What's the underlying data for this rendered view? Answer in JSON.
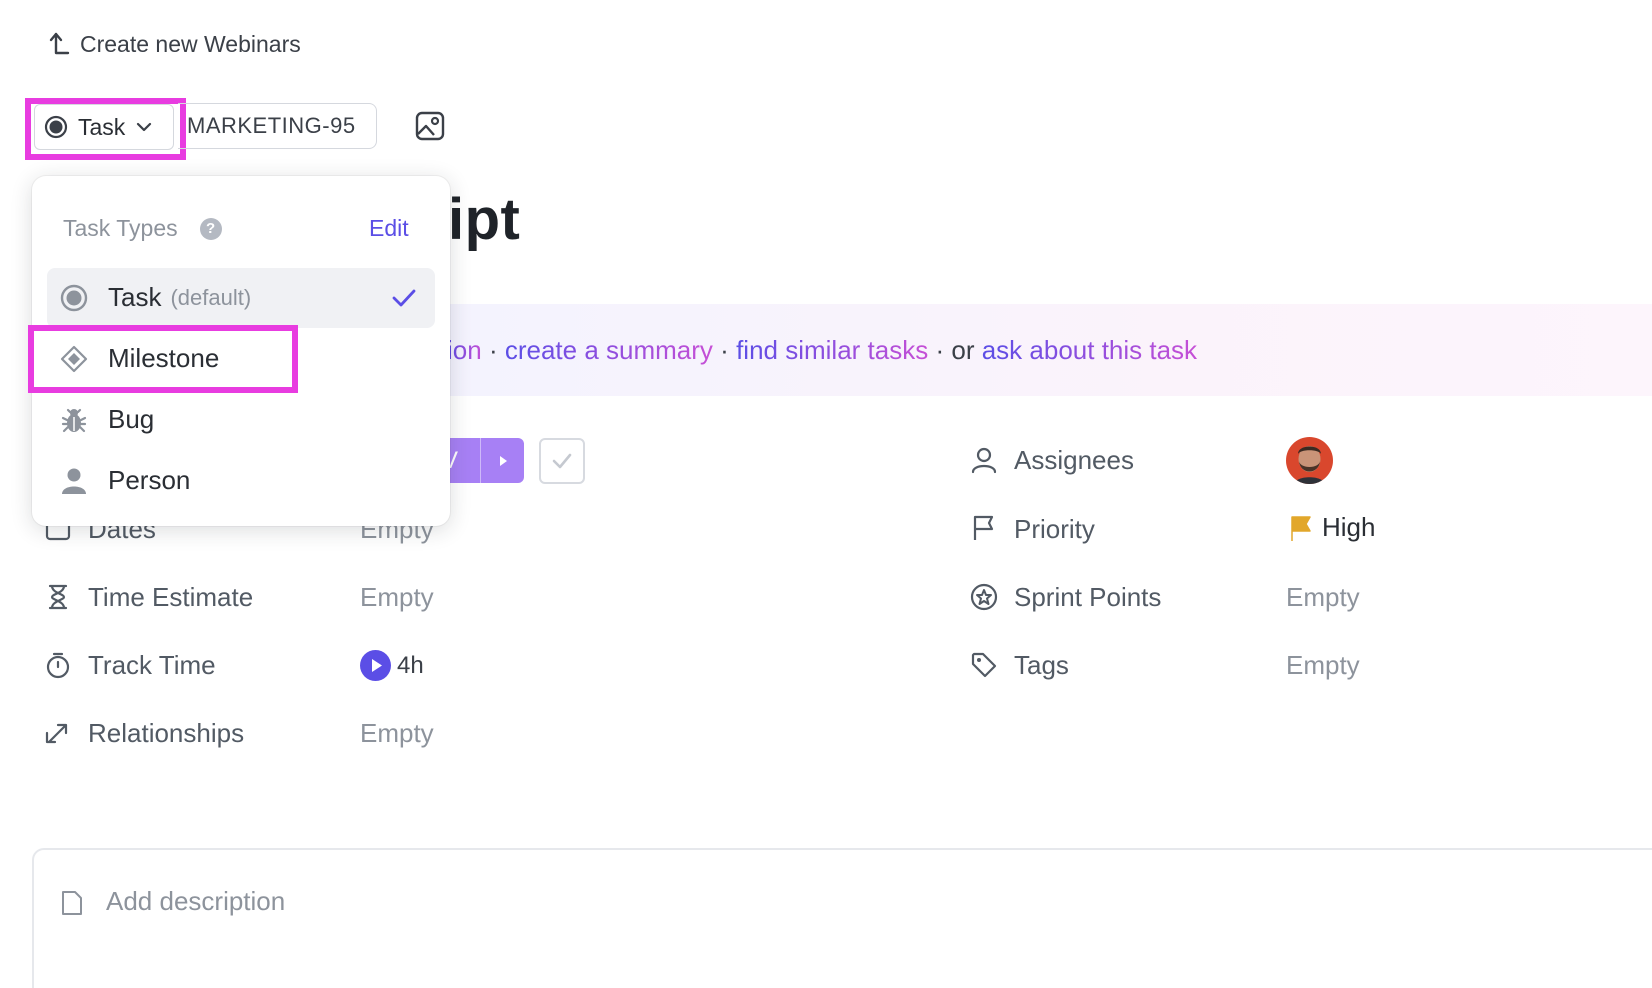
{
  "breadcrumb": {
    "label": "Create new Webinars",
    "icon": "arrow-up-left-icon"
  },
  "task_type_button": {
    "label": "Task",
    "icon": "task-circle-icon"
  },
  "task_id": "MARKETING-95",
  "title_visible": "ipt",
  "ai_banner": {
    "partial_link": "ion",
    "sep": "·",
    "links": [
      "create a summary",
      "find similar tasks"
    ],
    "or_text": "or",
    "last_link": "ask about this task"
  },
  "status": {
    "label_partial": "V"
  },
  "fields_left": [
    {
      "label": "Dates",
      "value": "Empty",
      "icon": "calendar-icon"
    },
    {
      "label": "Time Estimate",
      "value": "Empty",
      "icon": "hourglass-icon"
    },
    {
      "label": "Track Time",
      "value": "4h",
      "icon": "stopwatch-icon"
    },
    {
      "label": "Relationships",
      "value": "Empty",
      "icon": "relationship-arrows-icon"
    }
  ],
  "fields_right": [
    {
      "label": "Assignees",
      "icon": "user-icon"
    },
    {
      "label": "Priority",
      "value": "High",
      "icon": "flag-outline-icon"
    },
    {
      "label": "Sprint Points",
      "value": "Empty",
      "icon": "sprint-points-icon"
    },
    {
      "label": "Tags",
      "value": "Empty",
      "icon": "tag-icon"
    }
  ],
  "description_placeholder": "Add description",
  "dropdown": {
    "header": "Task Types",
    "edit_label": "Edit",
    "items": [
      {
        "label": "Task",
        "suffix": "(default)",
        "icon": "task-circle-icon",
        "selected": true
      },
      {
        "label": "Milestone",
        "icon": "milestone-diamond-icon"
      },
      {
        "label": "Bug",
        "icon": "bug-icon"
      },
      {
        "label": "Person",
        "icon": "person-icon"
      }
    ]
  },
  "colors": {
    "highlight": "#e83ce0",
    "accent": "#5b4ee6",
    "status_purple": "#a780f5",
    "priority_high": "#f0b429"
  }
}
